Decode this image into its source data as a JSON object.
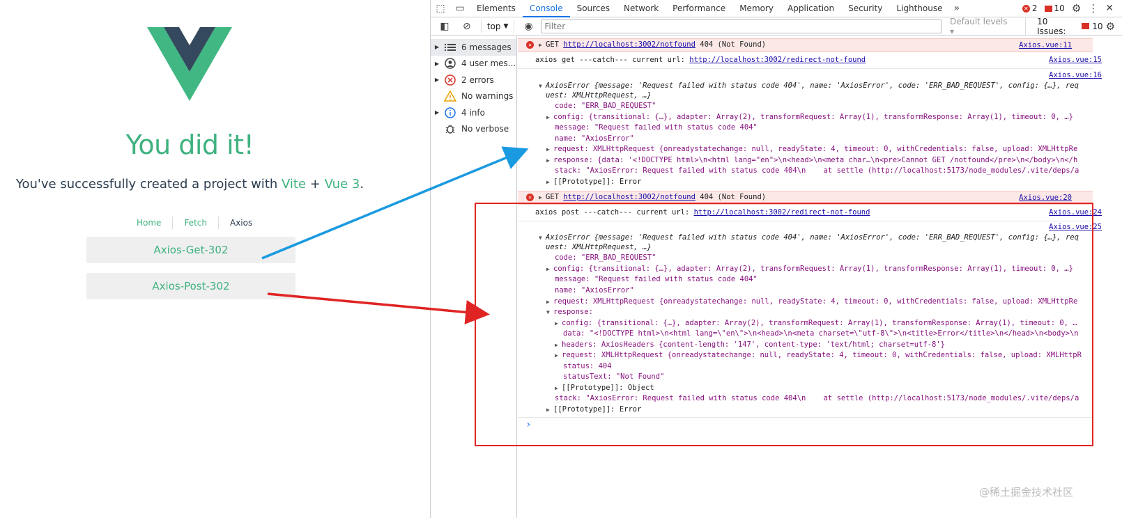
{
  "page": {
    "heading": "You did it!",
    "subtitle_prefix": "You've successfully created a project with ",
    "vite": "Vite",
    "plus": " + ",
    "vue": "Vue 3",
    "period": ".",
    "nav": [
      "Home",
      "Fetch",
      "Axios"
    ],
    "btn_get": "Axios-Get-302",
    "btn_post": "Axios-Post-302"
  },
  "devtools": {
    "tabs": [
      "Elements",
      "Console",
      "Sources",
      "Network",
      "Performance",
      "Memory",
      "Application",
      "Security",
      "Lighthouse"
    ],
    "more": "»",
    "error_count": "2",
    "issue_count": "10",
    "context": "top",
    "filter_placeholder": "Filter",
    "levels": "Default levels ▾",
    "issues_label": "10 Issues:",
    "issues_count": "10",
    "sidebar": [
      {
        "label": "6 messages",
        "icon": "list-icon"
      },
      {
        "label": "4 user mes...",
        "icon": "user-icon"
      },
      {
        "label": "2 errors",
        "icon": "error-icon"
      },
      {
        "label": "No warnings",
        "icon": "warning-icon"
      },
      {
        "label": "4 info",
        "icon": "info-icon"
      },
      {
        "label": "No verbose",
        "icon": "bug-icon"
      }
    ],
    "colors": {
      "accent": "#1a73e8",
      "error": "#d93025",
      "vue_green": "#3fb27f",
      "vue_dark": "#35495e"
    },
    "messages": {
      "get1": {
        "method": "GET ",
        "url": "http://localhost:3002/notfound",
        "status": " 404 (Not Found)",
        "src": "Axios.vue:11"
      },
      "log1": {
        "text": "axios get ---catch--- current url: ",
        "url": "http://localhost:3002/redirect-not-found",
        "src": "Axios.vue:15"
      },
      "src16": "Axios.vue:16",
      "err_obj_1": "AxiosError {message: 'Request failed with status code 404', name: 'AxiosError', code: 'ERR_BAD_REQUEST', config: {…}, req",
      "err_obj_2": "uest: XMLHttpRequest, …}",
      "code_line": "code: \"ERR_BAD_REQUEST\"",
      "config_line": "config: {transitional: {…}, adapter: Array(2), transformRequest: Array(1), transformResponse: Array(1), timeout: 0, …}",
      "message_line": "message: \"Request failed with status code 404\"",
      "name_line": "name: \"AxiosError\"",
      "request_line": "request: XMLHttpRequest {onreadystatechange: null, readyState: 4, timeout: 0, withCredentials: false, upload: XMLHttpRe",
      "response_collapsed": "response: {data: '<!DOCTYPE html>\\n<html lang=\"en\">\\n<head>\\n<meta char…\\n<pre>Cannot GET /notfound</pre>\\n</body>\\n</h",
      "stack_line": "stack: \"AxiosError: Request failed with status code 404\\n    at settle (http://localhost:5173/node_modules/.vite/deps/a",
      "proto_error": "[[Prototype]]: Error",
      "get2": {
        "method": "GET ",
        "url": "http://localhost:3002/notfound",
        "status": " 404 (Not Found)",
        "src": "Axios.vue:20"
      },
      "log2": {
        "text": "axios post ---catch--- current url: ",
        "url": "http://localhost:3002/redirect-not-found",
        "src": "Axios.vue:24"
      },
      "src25": "Axios.vue:25",
      "response_expanded": "response:",
      "r_config": "config: {transitional: {…}, adapter: Array(2), transformRequest: Array(1), transformResponse: Array(1), timeout: 0, …",
      "r_data": "data: \"<!DOCTYPE html>\\n<html lang=\\\"en\\\">\\n<head>\\n<meta charset=\\\"utf-8\\\">\\n<title>Error</title>\\n</head>\\n<body>\\n",
      "r_headers": "headers: AxiosHeaders {content-length: '147', content-type: 'text/html; charset=utf-8'}",
      "r_request": "request: XMLHttpRequest {onreadystatechange: null, readyState: 4, timeout: 0, withCredentials: false, upload: XMLHttpR",
      "r_status": "status: 404",
      "r_statusText": "statusText: \"Not Found\"",
      "r_proto": "[[Prototype]]: Object",
      "stack_line2": "stack: \"AxiosError: Request failed with status code 404\\n    at settle (http://localhost:5173/node_modules/.vite/deps/a",
      "prompt": "›"
    }
  },
  "watermark": "@稀土掘金技术社区"
}
